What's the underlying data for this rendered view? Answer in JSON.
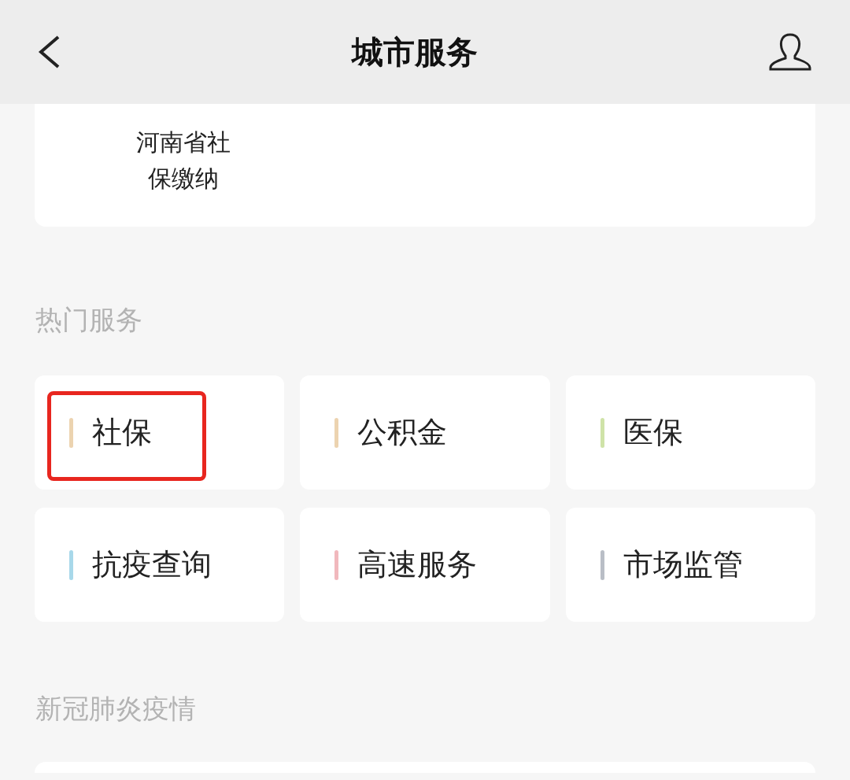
{
  "header": {
    "title": "城市服务"
  },
  "top_card": {
    "label": "河南省社保缴纳"
  },
  "sections": [
    {
      "title": "热门服务",
      "items": [
        {
          "label": "社保",
          "color": "#ecd3b0",
          "highlighted": true
        },
        {
          "label": "公积金",
          "color": "#ecd3b0",
          "highlighted": false
        },
        {
          "label": "医保",
          "color": "#cfe3a8",
          "highlighted": false
        },
        {
          "label": "抗疫查询",
          "color": "#a8d8ea",
          "highlighted": false
        },
        {
          "label": "高速服务",
          "color": "#f1b8bd",
          "highlighted": false
        },
        {
          "label": "市场监管",
          "color": "#b9bec6",
          "highlighted": false
        }
      ]
    },
    {
      "title": "新冠肺炎疫情"
    }
  ]
}
